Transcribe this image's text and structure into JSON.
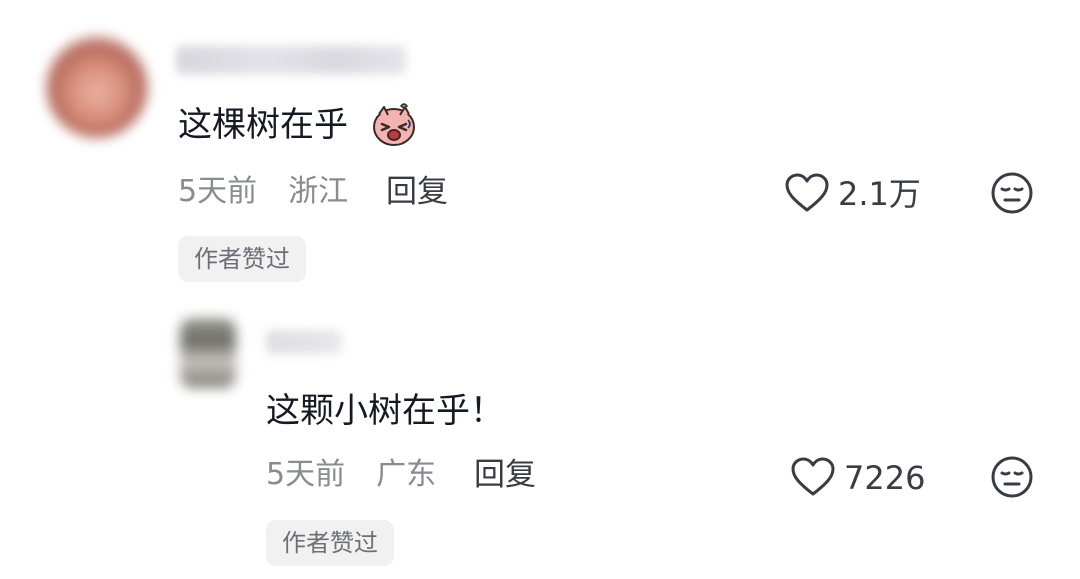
{
  "comments": [
    {
      "username": "",
      "text": "这棵树在乎",
      "emoji_icon": "crying-laughing-sticker-icon",
      "time": "5天前",
      "location": "浙江",
      "reply_label": "回复",
      "like_count": "2.1万",
      "badge": "作者赞过",
      "replies": [
        {
          "username": "",
          "text": "这颗小树在乎！",
          "time": "5天前",
          "location": "广东",
          "reply_label": "回复",
          "like_count": "7226",
          "badge": "作者赞过"
        }
      ]
    }
  ],
  "colors": {
    "text_primary": "#161823",
    "text_secondary": "#8a8b91",
    "icon_stroke": "#3a3b44",
    "badge_bg": "#f1f1f2",
    "emoji_pink": "#f2a8a8"
  }
}
